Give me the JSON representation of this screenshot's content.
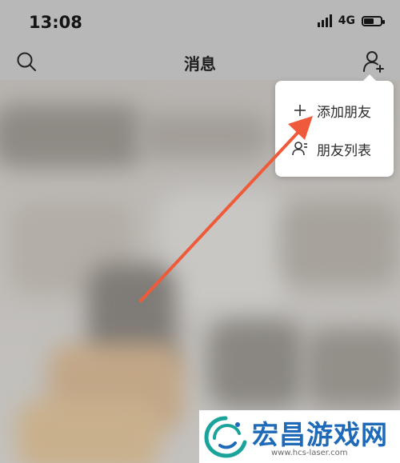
{
  "status_bar": {
    "time": "13:08",
    "network": "4G",
    "battery_level": 0.6
  },
  "nav": {
    "title": "消息",
    "left_icon": "search-icon",
    "right_icon": "add-user-icon"
  },
  "popup_menu": {
    "items": [
      {
        "label": "添加朋友",
        "icon": "plus-icon"
      },
      {
        "label": "朋友列表",
        "icon": "contacts-icon"
      }
    ]
  },
  "annotation": {
    "arrow_color": "#ee5a3a"
  },
  "watermark": {
    "title": "宏昌游戏网",
    "url": "www.hcs-laser.com",
    "brand_color": "#1e6ab8",
    "logo_color": "#1aa39a"
  }
}
